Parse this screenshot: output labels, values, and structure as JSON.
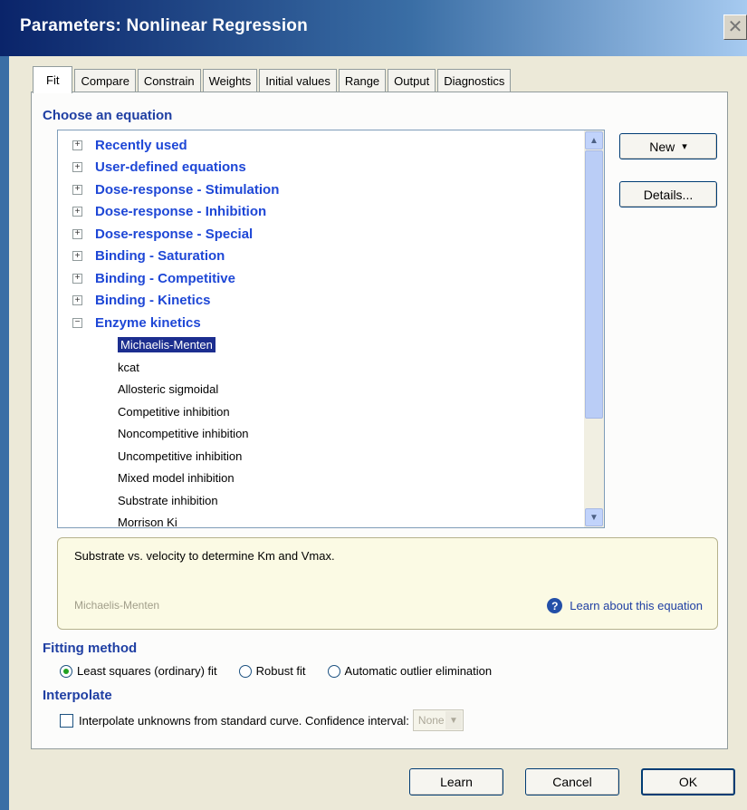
{
  "window": {
    "title": "Parameters: Nonlinear Regression",
    "close_icon": "close-icon"
  },
  "tabs": [
    {
      "label": "Fit",
      "active": true
    },
    {
      "label": "Compare"
    },
    {
      "label": "Constrain"
    },
    {
      "label": "Weights"
    },
    {
      "label": "Initial values"
    },
    {
      "label": "Range"
    },
    {
      "label": "Output"
    },
    {
      "label": "Diagnostics"
    }
  ],
  "choose_equation": {
    "label": "Choose an equation",
    "categories": [
      {
        "label": "Recently used",
        "expanded": false
      },
      {
        "label": "User-defined equations",
        "expanded": false
      },
      {
        "label": "Dose-response - Stimulation",
        "expanded": false
      },
      {
        "label": "Dose-response - Inhibition",
        "expanded": false
      },
      {
        "label": "Dose-response - Special",
        "expanded": false
      },
      {
        "label": "Binding - Saturation",
        "expanded": false
      },
      {
        "label": "Binding - Competitive",
        "expanded": false
      },
      {
        "label": "Binding - Kinetics",
        "expanded": false
      },
      {
        "label": "Enzyme kinetics",
        "expanded": true
      }
    ],
    "equations": [
      {
        "label": "Michaelis-Menten",
        "selected": true
      },
      {
        "label": "kcat"
      },
      {
        "label": "Allosteric sigmoidal"
      },
      {
        "label": "Competitive inhibition"
      },
      {
        "label": "Noncompetitive inhibition"
      },
      {
        "label": "Uncompetitive inhibition"
      },
      {
        "label": "Mixed model inhibition"
      },
      {
        "label": "Substrate inhibition"
      },
      {
        "label": "Morrison Ki"
      }
    ],
    "expand_glyph": "+",
    "collapse_glyph": "−"
  },
  "buttons": {
    "new": "New",
    "new_arrow": "▾",
    "details": "Details...",
    "learn": "Learn",
    "cancel": "Cancel",
    "ok": "OK"
  },
  "description": {
    "text": "Substrate vs. velocity to determine Km and Vmax.",
    "equation_name": "Michaelis-Menten",
    "learn_link": "Learn about this equation",
    "help_icon_glyph": "?"
  },
  "fitting_method": {
    "label": "Fitting method",
    "options": [
      {
        "label": "Least squares (ordinary) fit",
        "selected": true
      },
      {
        "label": "Robust fit",
        "selected": false
      },
      {
        "label": "Automatic outlier elimination",
        "selected": false
      }
    ]
  },
  "interpolate": {
    "label": "Interpolate",
    "checkbox_label": "Interpolate unknowns from standard curve. Confidence interval:",
    "checked": false,
    "ci_value": "None"
  },
  "colors": {
    "title_blue": "#0a246a",
    "section_blue": "#1f3fa3",
    "selection": "#1c2e8f",
    "desc_bg": "#fbfae4"
  }
}
